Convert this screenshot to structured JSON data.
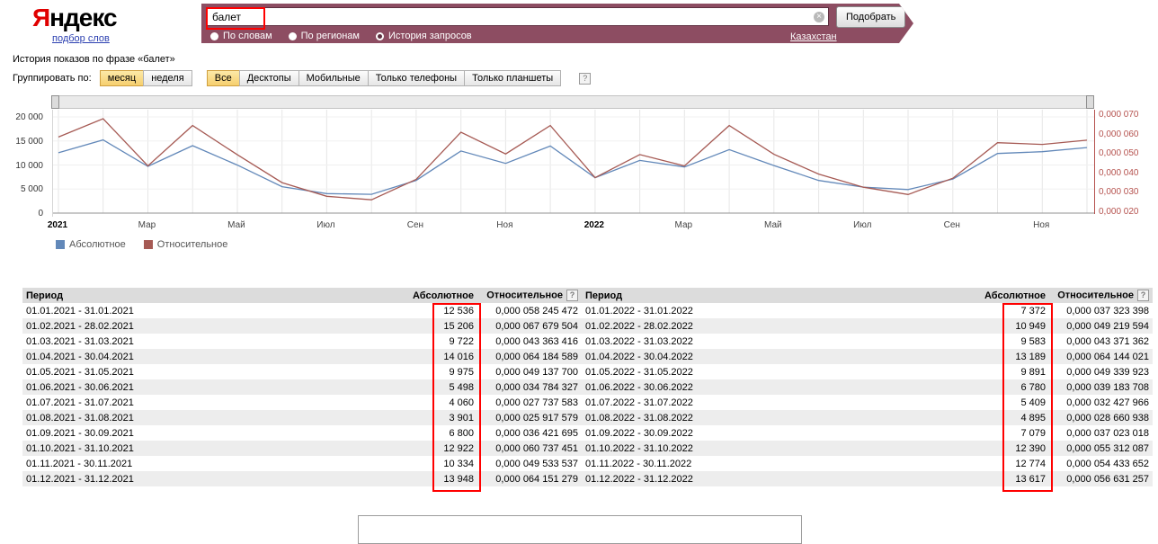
{
  "header": {
    "logo_first": "Я",
    "logo_rest": "ндекс",
    "logo_sub": "подбор слов",
    "search": {
      "value": "балет",
      "submit": "Подобрать",
      "clear_icon": "×"
    },
    "modes": [
      {
        "label": "По словам",
        "selected": false
      },
      {
        "label": "По регионам",
        "selected": false
      },
      {
        "label": "История запросов",
        "selected": true
      }
    ],
    "region": "Казахстан"
  },
  "toolbar": {
    "title": "История показов по фразе «балет»",
    "group_label": "Группировать по:",
    "period_options": [
      {
        "label": "месяц",
        "active": true
      },
      {
        "label": "неделя",
        "active": false
      }
    ],
    "device_options": [
      {
        "label": "Все",
        "active": true
      },
      {
        "label": "Десктопы",
        "active": false
      },
      {
        "label": "Мобильные",
        "active": false
      },
      {
        "label": "Только телефоны",
        "active": false
      },
      {
        "label": "Только планшеты",
        "active": false
      }
    ],
    "help_icon": "?"
  },
  "chart_data": {
    "type": "line",
    "title": "История показов по фразе «балет»",
    "x": [
      "2021-01",
      "2021-02",
      "2021-03",
      "2021-04",
      "2021-05",
      "2021-06",
      "2021-07",
      "2021-08",
      "2021-09",
      "2021-10",
      "2021-11",
      "2021-12",
      "2022-01",
      "2022-02",
      "2022-03",
      "2022-04",
      "2022-05",
      "2022-06",
      "2022-07",
      "2022-08",
      "2022-09",
      "2022-10",
      "2022-11",
      "2022-12"
    ],
    "x_ticks": [
      {
        "index": 0,
        "label": "2021",
        "bold": true
      },
      {
        "index": 2,
        "label": "Мар",
        "bold": false
      },
      {
        "index": 4,
        "label": "Май",
        "bold": false
      },
      {
        "index": 6,
        "label": "Июл",
        "bold": false
      },
      {
        "index": 8,
        "label": "Сен",
        "bold": false
      },
      {
        "index": 10,
        "label": "Ноя",
        "bold": false
      },
      {
        "index": 12,
        "label": "2022",
        "bold": true
      },
      {
        "index": 14,
        "label": "Мар",
        "bold": false
      },
      {
        "index": 16,
        "label": "Май",
        "bold": false
      },
      {
        "index": 18,
        "label": "Июл",
        "bold": false
      },
      {
        "index": 20,
        "label": "Сен",
        "bold": false
      },
      {
        "index": 22,
        "label": "Ноя",
        "bold": false
      }
    ],
    "series": [
      {
        "name": "Абсолютное",
        "axis": "left",
        "color": "#6288b9",
        "values": [
          12536,
          15206,
          9722,
          14016,
          9975,
          5498,
          4060,
          3901,
          6800,
          12922,
          10334,
          13948,
          7372,
          10949,
          9583,
          13189,
          9891,
          6780,
          5409,
          4895,
          7079,
          12390,
          12774,
          13617
        ]
      },
      {
        "name": "Относительное",
        "axis": "right",
        "color": "#a65a54",
        "values": [
          5.8245472e-05,
          6.7679504e-05,
          4.3363416e-05,
          6.4184589e-05,
          4.91377e-05,
          3.4784327e-05,
          2.7737583e-05,
          2.5917579e-05,
          3.6421695e-05,
          6.0737451e-05,
          4.9533537e-05,
          6.4151279e-05,
          3.7323398e-05,
          4.9219594e-05,
          4.3371362e-05,
          6.4144021e-05,
          4.9339923e-05,
          3.9183708e-05,
          3.2427966e-05,
          2.8660938e-05,
          3.7023018e-05,
          5.5312087e-05,
          5.4433652e-05,
          5.6631257e-05
        ]
      }
    ],
    "left_axis": {
      "range": [
        0,
        20000
      ],
      "ticks": [
        {
          "label": "20 000",
          "value": 20000
        },
        {
          "label": "15 000",
          "value": 15000
        },
        {
          "label": "10 000",
          "value": 10000
        },
        {
          "label": "5 000",
          "value": 5000
        },
        {
          "label": "0",
          "value": 0
        }
      ]
    },
    "right_axis": {
      "range": [
        2e-05,
        7e-05
      ],
      "color": "#b5524e",
      "ticks": [
        {
          "label": "0,000 070",
          "value": 7e-05
        },
        {
          "label": "0,000 060",
          "value": 6e-05
        },
        {
          "label": "0,000 050",
          "value": 5e-05
        },
        {
          "label": "0,000 040",
          "value": 4e-05
        },
        {
          "label": "0,000 030",
          "value": 3e-05
        },
        {
          "label": "0,000 020",
          "value": 2e-05
        }
      ]
    },
    "grid": true,
    "legend_position": "bottom-left"
  },
  "legend": [
    {
      "label": "Абсолютное",
      "color": "#6288b9"
    },
    {
      "label": "Относительное",
      "color": "#a65a54"
    }
  ],
  "table": {
    "headers": [
      "Период",
      "Абсолютное",
      "Относительное"
    ],
    "left_rows": [
      {
        "period": "01.01.2021 - 31.01.2021",
        "abs": "12 536",
        "rel": "0,000 058 245 472"
      },
      {
        "period": "01.02.2021 - 28.02.2021",
        "abs": "15 206",
        "rel": "0,000 067 679 504"
      },
      {
        "period": "01.03.2021 - 31.03.2021",
        "abs": "9 722",
        "rel": "0,000 043 363 416"
      },
      {
        "period": "01.04.2021 - 30.04.2021",
        "abs": "14 016",
        "rel": "0,000 064 184 589"
      },
      {
        "period": "01.05.2021 - 31.05.2021",
        "abs": "9 975",
        "rel": "0,000 049 137 700"
      },
      {
        "period": "01.06.2021 - 30.06.2021",
        "abs": "5 498",
        "rel": "0,000 034 784 327"
      },
      {
        "period": "01.07.2021 - 31.07.2021",
        "abs": "4 060",
        "rel": "0,000 027 737 583"
      },
      {
        "period": "01.08.2021 - 31.08.2021",
        "abs": "3 901",
        "rel": "0,000 025 917 579"
      },
      {
        "period": "01.09.2021 - 30.09.2021",
        "abs": "6 800",
        "rel": "0,000 036 421 695"
      },
      {
        "period": "01.10.2021 - 31.10.2021",
        "abs": "12 922",
        "rel": "0,000 060 737 451"
      },
      {
        "period": "01.11.2021 - 30.11.2021",
        "abs": "10 334",
        "rel": "0,000 049 533 537"
      },
      {
        "period": "01.12.2021 - 31.12.2021",
        "abs": "13 948",
        "rel": "0,000 064 151 279"
      }
    ],
    "right_rows": [
      {
        "period": "01.01.2022 - 31.01.2022",
        "abs": "7 372",
        "rel": "0,000 037 323 398"
      },
      {
        "period": "01.02.2022 - 28.02.2022",
        "abs": "10 949",
        "rel": "0,000 049 219 594"
      },
      {
        "period": "01.03.2022 - 31.03.2022",
        "abs": "9 583",
        "rel": "0,000 043 371 362"
      },
      {
        "period": "01.04.2022 - 30.04.2022",
        "abs": "13 189",
        "rel": "0,000 064 144 021"
      },
      {
        "period": "01.05.2022 - 31.05.2022",
        "abs": "9 891",
        "rel": "0,000 049 339 923"
      },
      {
        "period": "01.06.2022 - 30.06.2022",
        "abs": "6 780",
        "rel": "0,000 039 183 708"
      },
      {
        "period": "01.07.2022 - 31.07.2022",
        "abs": "5 409",
        "rel": "0,000 032 427 966"
      },
      {
        "period": "01.08.2022 - 31.08.2022",
        "abs": "4 895",
        "rel": "0,000 028 660 938"
      },
      {
        "period": "01.09.2022 - 30.09.2022",
        "abs": "7 079",
        "rel": "0,000 037 023 018"
      },
      {
        "period": "01.10.2022 - 31.10.2022",
        "abs": "12 390",
        "rel": "0,000 055 312 087"
      },
      {
        "period": "01.11.2022 - 30.11.2022",
        "abs": "12 774",
        "rel": "0,000 054 433 652"
      },
      {
        "period": "01.12.2022 - 31.12.2022",
        "abs": "13 617",
        "rel": "0,000 056 631 257"
      }
    ]
  },
  "annotations": {
    "highlight_color": "#ff0000"
  },
  "colors": {
    "band": "#8d4d62",
    "active_button": "#f6cf6e"
  }
}
